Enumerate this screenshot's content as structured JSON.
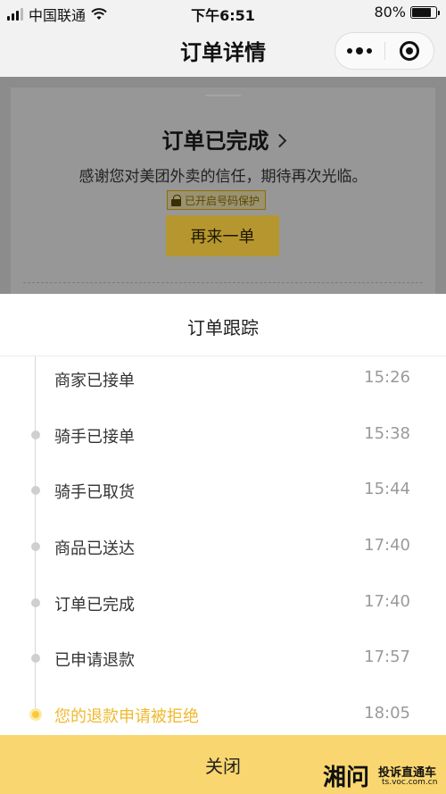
{
  "status_bar": {
    "carrier": "中国联通",
    "time": "下午6:51",
    "battery": "80%",
    "battery_level": 0.8
  },
  "nav": {
    "title": "订单详情",
    "more_icon": "more-dots-icon",
    "close_icon": "mini-program-close-icon"
  },
  "order_card": {
    "status": "订单已完成",
    "thanks": "感谢您对美团外卖的信任，期待再次光临。",
    "privacy_badge": "已开启号码保护",
    "reorder_button": "再来一单"
  },
  "tracking_sheet": {
    "title": "订单跟踪",
    "events": [
      {
        "label": "商家已接单",
        "time": "15:26"
      },
      {
        "label": "骑手已接单",
        "time": "15:38"
      },
      {
        "label": "骑手已取货",
        "time": "15:44"
      },
      {
        "label": "商品已送达",
        "time": "17:40"
      },
      {
        "label": "订单已完成",
        "time": "17:40"
      },
      {
        "label": "已申请退款",
        "time": "17:57"
      },
      {
        "label": "您的退款申请被拒绝",
        "time": "18:05"
      }
    ],
    "close_button": "关闭",
    "active_color": "#f0b92e"
  },
  "watermark": {
    "logo": "湘问",
    "text": "投诉直通车",
    "url": "ts.voc.com.cn"
  }
}
